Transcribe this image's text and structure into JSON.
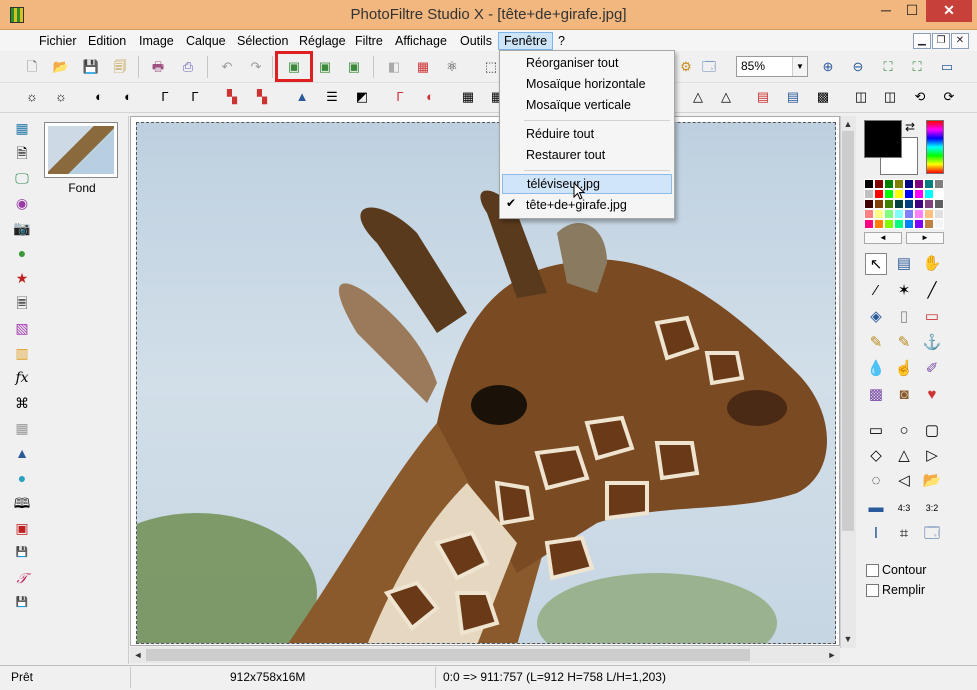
{
  "window": {
    "title": "PhotoFiltre Studio X - [tête+de+girafe.jpg]",
    "min": "─",
    "max": "☐",
    "close": "✕"
  },
  "menubar": {
    "items": [
      "Fichier",
      "Edition",
      "Image",
      "Calque",
      "Sélection",
      "Réglage",
      "Filtre",
      "Affichage",
      "Outils",
      "Fenêtre",
      "?"
    ],
    "active": "Fenêtre"
  },
  "mdi": {
    "min": "▁",
    "restore": "❐",
    "close": "✕"
  },
  "zoom": {
    "value": "85%",
    "arrow": "▼"
  },
  "layers": [
    {
      "name": "Fond"
    }
  ],
  "window_menu": {
    "items": [
      "Réorganiser tout",
      "Mosaïque horizontale",
      "Mosaïque verticale",
      "Réduire tout",
      "Restaurer tout",
      "téléviseur.jpg",
      "tête+de+girafe.jpg"
    ],
    "highlighted": "téléviseur.jpg",
    "checked": "tête+de+girafe.jpg",
    "check_glyph": "✔"
  },
  "options": {
    "contour": "Contour",
    "remplir": "Remplir"
  },
  "palette_nav": {
    "prev": "◄",
    "next": "►"
  },
  "status": {
    "state": "Prêt",
    "size": "912x758x16M",
    "coords": "0:0 => 911:757 (L=912  H=758  L/H=1,203)"
  },
  "colors": {
    "titlebar": "#f1b77f",
    "close": "#c7403a",
    "highlight": "#e02020",
    "menu_active": "#cde4f7"
  }
}
